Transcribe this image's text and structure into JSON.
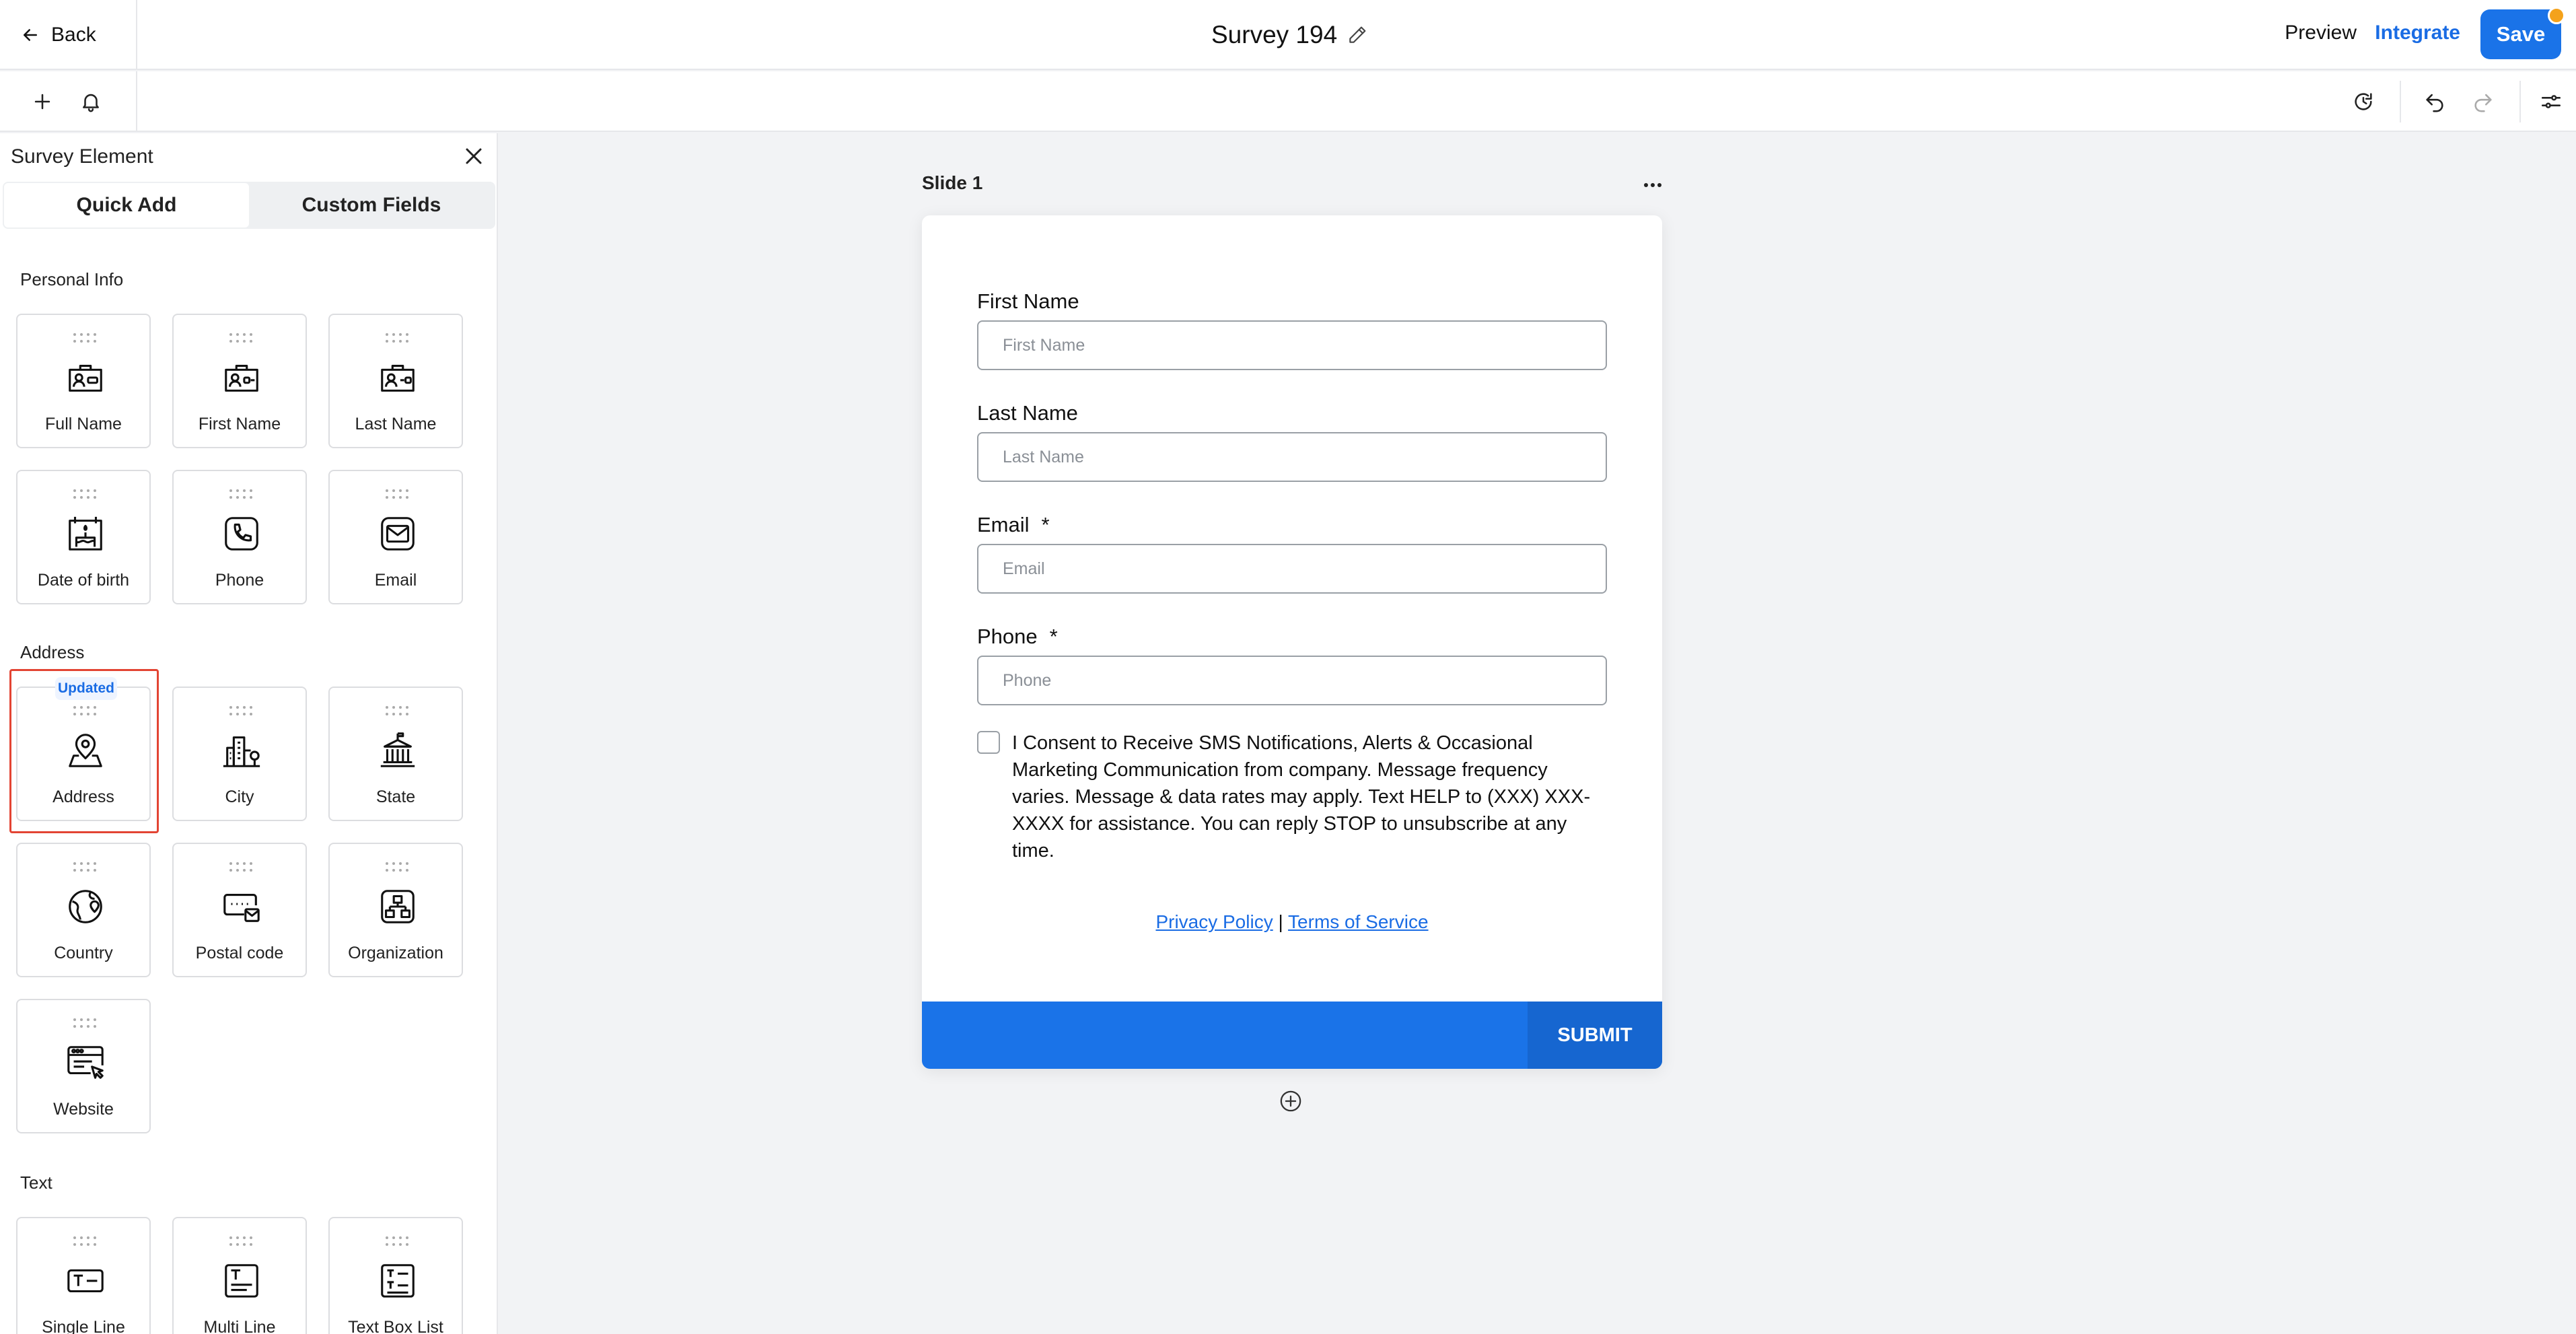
{
  "header": {
    "back_label": "Back",
    "title": "Survey 194",
    "preview_label": "Preview",
    "integrate_label": "Integrate",
    "save_label": "Save"
  },
  "toolbar": {
    "left_icons": [
      "plus-icon",
      "bell-icon"
    ],
    "right_icons": [
      "history-icon",
      "undo-icon",
      "redo-icon",
      "settings-sliders-icon"
    ]
  },
  "panel": {
    "title": "Survey Element",
    "tabs": [
      {
        "label": "Quick Add",
        "active": true
      },
      {
        "label": "Custom Fields",
        "active": false
      }
    ],
    "sections": [
      {
        "title": "Personal Info",
        "items": [
          {
            "label": "Full Name",
            "icon": "id-card-icon"
          },
          {
            "label": "First Name",
            "icon": "id-card-icon"
          },
          {
            "label": "Last Name",
            "icon": "id-card-icon"
          },
          {
            "label": "Date of birth",
            "icon": "birthday-cake-icon"
          },
          {
            "label": "Phone",
            "icon": "phone-icon"
          },
          {
            "label": "Email",
            "icon": "mail-icon"
          }
        ]
      },
      {
        "title": "Address",
        "items": [
          {
            "label": "Address",
            "icon": "map-pin-icon",
            "badge": "Updated"
          },
          {
            "label": "City",
            "icon": "city-buildings-icon"
          },
          {
            "label": "State",
            "icon": "capitol-building-icon"
          },
          {
            "label": "Country",
            "icon": "globe-pin-icon"
          },
          {
            "label": "Postal code",
            "icon": "postal-code-icon"
          },
          {
            "label": "Organization",
            "icon": "org-chart-icon"
          },
          {
            "label": "Website",
            "icon": "browser-cursor-icon"
          }
        ]
      },
      {
        "title": "Text",
        "items": [
          {
            "label": "Single Line",
            "icon": "text-single-line-icon"
          },
          {
            "label": "Multi Line",
            "icon": "text-multi-line-icon"
          },
          {
            "label": "Text Box List",
            "icon": "text-box-list-icon"
          }
        ]
      }
    ]
  },
  "canvas": {
    "slide_label": "Slide 1",
    "fields": [
      {
        "label": "First Name",
        "placeholder": "First Name",
        "required": false
      },
      {
        "label": "Last Name",
        "placeholder": "Last Name",
        "required": false
      },
      {
        "label": "Email",
        "placeholder": "Email",
        "required": true
      },
      {
        "label": "Phone",
        "placeholder": "Phone",
        "required": true
      }
    ],
    "required_marker": "*",
    "consent_text": "I Consent to Receive SMS Notifications, Alerts & Occasional Marketing Communication from company. Message frequency varies. Message & data rates may apply. Text HELP to (XXX) XXX-XXXX for assistance. You can reply STOP to unsubscribe at any time.",
    "privacy_label": "Privacy Policy",
    "links_separator": "|",
    "terms_label": "Terms of Service",
    "submit_label": "SUBMIT"
  },
  "colors": {
    "accent": "#1a73e8",
    "highlight_border": "#e34433",
    "badge_text": "#1a6ce4",
    "save_notification_dot": "#f4a21b"
  }
}
